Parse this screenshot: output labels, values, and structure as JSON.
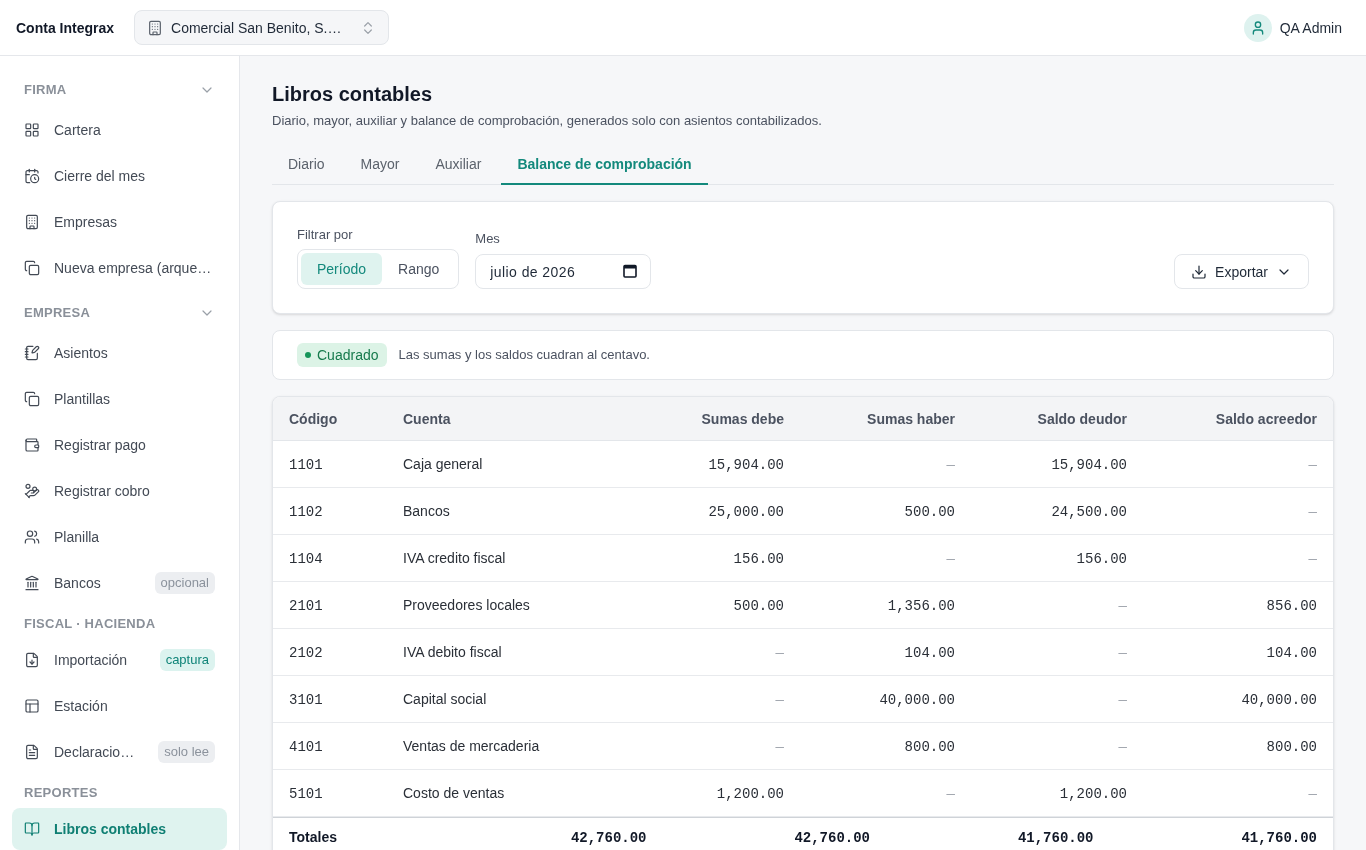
{
  "header": {
    "brand": "Conta Integrax",
    "company": "Comercial San Benito, S.…",
    "user": "QA Admin"
  },
  "sidebar": {
    "sections": [
      {
        "title": "FIRMA",
        "collapsible": true,
        "items": [
          {
            "label": "Cartera",
            "selected": false
          },
          {
            "label": "Cierre del mes",
            "selected": false
          },
          {
            "label": "Empresas",
            "selected": false
          },
          {
            "label": "Nueva empresa (arque…",
            "selected": false
          }
        ]
      },
      {
        "title": "EMPRESA",
        "collapsible": true,
        "items": [
          {
            "label": "Asientos",
            "selected": false
          },
          {
            "label": "Plantillas",
            "selected": false
          },
          {
            "label": "Registrar pago",
            "selected": false
          },
          {
            "label": "Registrar cobro",
            "selected": false
          },
          {
            "label": "Planilla",
            "selected": false
          },
          {
            "label": "Bancos",
            "selected": false,
            "badge": {
              "label": "opcional",
              "kind": "neutral"
            }
          }
        ]
      },
      {
        "title": "FISCAL · HACIENDA",
        "collapsible": false,
        "items": [
          {
            "label": "Importación",
            "selected": false,
            "badge": {
              "label": "captura",
              "kind": "accent"
            }
          },
          {
            "label": "Estación",
            "selected": false
          },
          {
            "label": "Declaracio…",
            "selected": false,
            "badge": {
              "label": "solo lee",
              "kind": "neutral"
            }
          }
        ]
      },
      {
        "title": "REPORTES",
        "collapsible": false,
        "items": [
          {
            "label": "Libros contables",
            "selected": true
          }
        ]
      }
    ]
  },
  "page": {
    "title": "Libros contables",
    "subtitle": "Diario, mayor, auxiliar y balance de comprobación, generados solo con asientos contabilizados."
  },
  "tabs": [
    {
      "label": "Diario",
      "selected": false
    },
    {
      "label": "Mayor",
      "selected": false
    },
    {
      "label": "Auxiliar",
      "selected": false
    },
    {
      "label": "Balance de comprobación",
      "selected": true
    }
  ],
  "filters": {
    "label": "Filtrar por",
    "modes": [
      {
        "label": "Período",
        "selected": true
      },
      {
        "label": "Rango",
        "selected": false
      }
    ],
    "month": {
      "label": "Mes",
      "value": "julio de 2026"
    },
    "export": "Exportar"
  },
  "status": {
    "badge": "Cuadrado",
    "message": "Las sumas y los saldos cuadran al centavo."
  },
  "table": {
    "columns": [
      "Código",
      "Cuenta",
      "Sumas debe",
      "Sumas haber",
      "Saldo deudor",
      "Saldo acreedor"
    ],
    "rows": [
      {
        "code": "1101",
        "account": "Caja general",
        "values": [
          {
            "text": "15,904.00",
            "muted": false
          },
          {
            "text": "—",
            "muted": true
          },
          {
            "text": "15,904.00",
            "muted": false
          },
          {
            "text": "—",
            "muted": true
          }
        ]
      },
      {
        "code": "1102",
        "account": "Bancos",
        "values": [
          {
            "text": "25,000.00",
            "muted": false
          },
          {
            "text": "500.00",
            "muted": false
          },
          {
            "text": "24,500.00",
            "muted": false
          },
          {
            "text": "—",
            "muted": true
          }
        ]
      },
      {
        "code": "1104",
        "account": "IVA credito fiscal",
        "values": [
          {
            "text": "156.00",
            "muted": false
          },
          {
            "text": "—",
            "muted": true
          },
          {
            "text": "156.00",
            "muted": false
          },
          {
            "text": "—",
            "muted": true
          }
        ]
      },
      {
        "code": "2101",
        "account": "Proveedores locales",
        "values": [
          {
            "text": "500.00",
            "muted": false
          },
          {
            "text": "1,356.00",
            "muted": false
          },
          {
            "text": "—",
            "muted": true
          },
          {
            "text": "856.00",
            "muted": false
          }
        ]
      },
      {
        "code": "2102",
        "account": "IVA debito fiscal",
        "values": [
          {
            "text": "—",
            "muted": true
          },
          {
            "text": "104.00",
            "muted": false
          },
          {
            "text": "—",
            "muted": true
          },
          {
            "text": "104.00",
            "muted": false
          }
        ]
      },
      {
        "code": "3101",
        "account": "Capital social",
        "values": [
          {
            "text": "—",
            "muted": true
          },
          {
            "text": "40,000.00",
            "muted": false
          },
          {
            "text": "—",
            "muted": true
          },
          {
            "text": "40,000.00",
            "muted": false
          }
        ]
      },
      {
        "code": "4101",
        "account": "Ventas de mercaderia",
        "values": [
          {
            "text": "—",
            "muted": true
          },
          {
            "text": "800.00",
            "muted": false
          },
          {
            "text": "—",
            "muted": true
          },
          {
            "text": "800.00",
            "muted": false
          }
        ]
      },
      {
        "code": "5101",
        "account": "Costo de ventas",
        "values": [
          {
            "text": "1,200.00",
            "muted": false
          },
          {
            "text": "—",
            "muted": true
          },
          {
            "text": "1,200.00",
            "muted": false
          },
          {
            "text": "—",
            "muted": true
          }
        ]
      }
    ],
    "totals": {
      "label": "Totales",
      "values": [
        "42,760.00",
        "42,760.00",
        "41,760.00",
        "41,760.00"
      ]
    }
  }
}
